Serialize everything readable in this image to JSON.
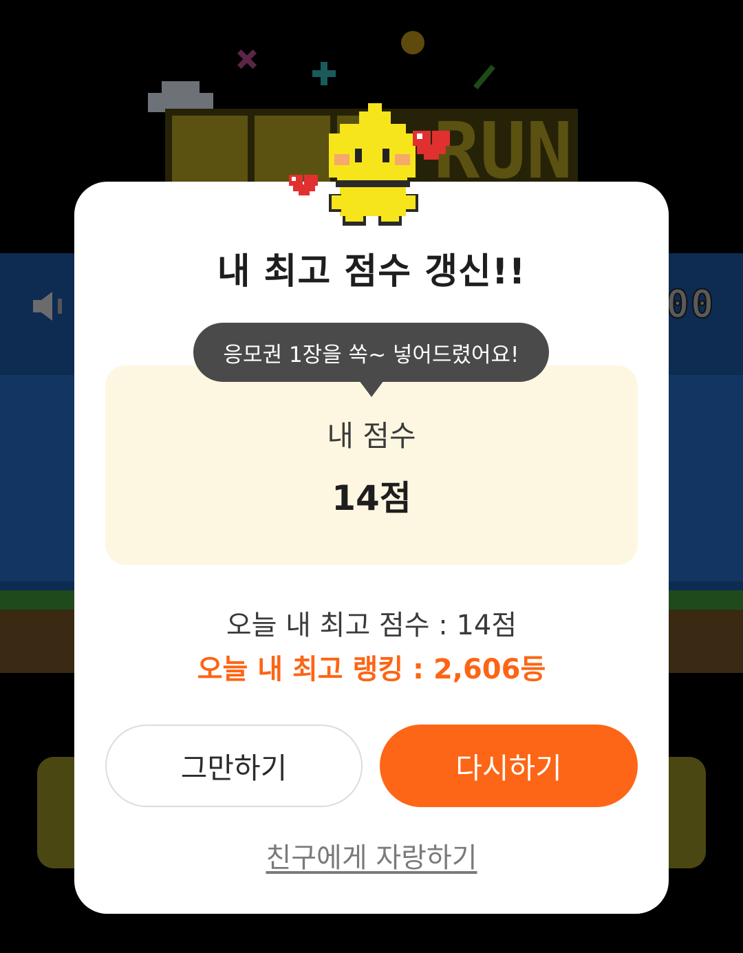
{
  "game": {
    "hud_score": "00",
    "sound_icon": "speaker-icon",
    "logo_text": "RUN"
  },
  "modal": {
    "title": "내 최고 점수 갱신!!",
    "tooltip": "응모권 1장을 쏙~ 넣어드렸어요!",
    "score_label": "내 점수",
    "score_value": "14점",
    "best_score": "오늘 내 최고 점수 : 14점",
    "best_rank": "오늘 내 최고 랭킹 : 2,606등",
    "quit_label": "그만하기",
    "retry_label": "다시하기",
    "share_label": "친구에게 자랑하기"
  },
  "colors": {
    "accent": "#fd6616",
    "rank_text": "#fd6514",
    "score_card_bg": "#fdf7e2",
    "tooltip_bg": "#4a4a4a",
    "mascot": "#f7e51c"
  }
}
